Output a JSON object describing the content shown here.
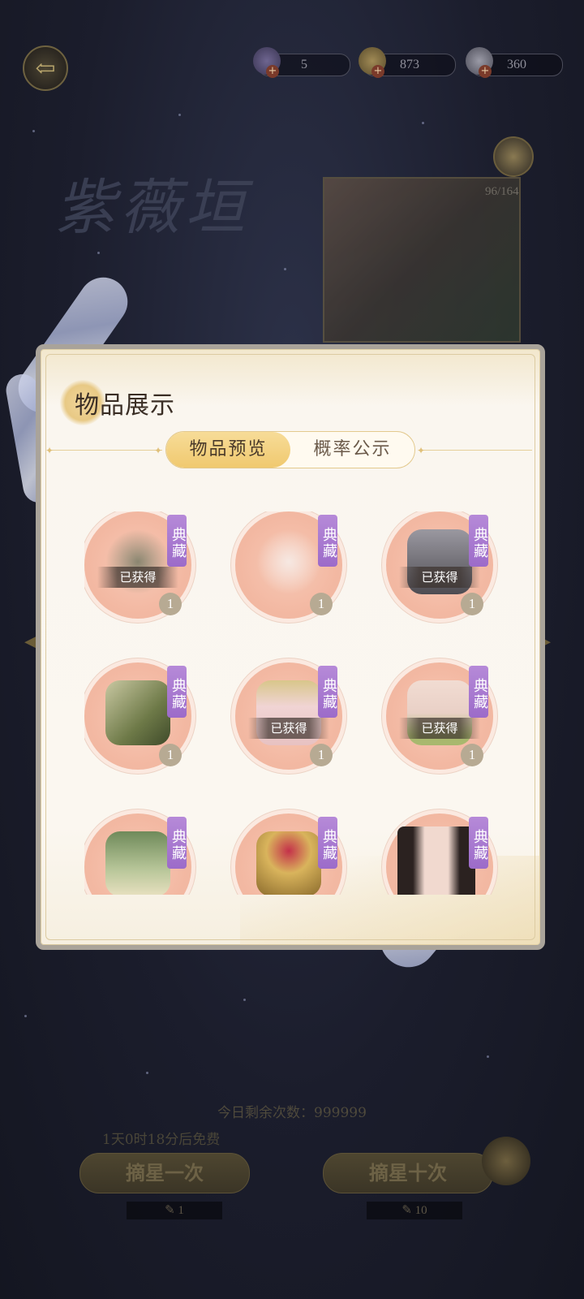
{
  "header": {
    "back_icon": "back-arrow-icon",
    "resources": [
      {
        "name": "ticket",
        "icon": "ticket-icon",
        "value": "5"
      },
      {
        "name": "coin",
        "icon": "coin-icon",
        "value": "873"
      },
      {
        "name": "pearl",
        "icon": "pearl-icon",
        "value": "360"
      }
    ]
  },
  "background": {
    "title": "紫薇垣",
    "progress": "96/164",
    "remaining_label": "今日剩余次数：999999",
    "free_timer": "1天0时18分后免费",
    "draw_once_label": "摘星一次",
    "draw_ten_label": "摘星十次",
    "draw_once_cost": "1",
    "draw_ten_cost": "10"
  },
  "modal": {
    "title": "物品展示",
    "tabs": [
      {
        "label": "物品预览",
        "active": true
      },
      {
        "label": "概率公示",
        "active": false
      }
    ],
    "items": [
      {
        "tag": "典藏",
        "obtained": "已获得",
        "count": "1",
        "art": "accessory-pieces",
        "color": "#8a8670"
      },
      {
        "tag": "典藏",
        "obtained": "",
        "count": "1",
        "art": "white-ribbon",
        "color": "#f1ddd3"
      },
      {
        "tag": "典藏",
        "obtained": "已获得",
        "count": "1",
        "art": "silver-chest",
        "color": "#6c6a70"
      },
      {
        "tag": "典藏",
        "obtained": "",
        "count": "1",
        "art": "green-robe",
        "color": "#7d8a5a"
      },
      {
        "tag": "典藏",
        "obtained": "已获得",
        "count": "1",
        "art": "veil-headdress",
        "color": "#e8c2c2"
      },
      {
        "tag": "典藏",
        "obtained": "已获得",
        "count": "1",
        "art": "green-shoe",
        "color": "#a8b86e"
      },
      {
        "tag": "典藏",
        "obtained": "",
        "count": "",
        "art": "green-dress",
        "color": "#9fb07c"
      },
      {
        "tag": "典藏",
        "obtained": "",
        "count": "",
        "art": "flower-basket",
        "color": "#c9a04a"
      },
      {
        "tag": "典藏",
        "obtained": "",
        "count": "",
        "art": "portrait-hair",
        "color": "#2b2220"
      }
    ]
  },
  "colors": {
    "tag_purple": "#9c6bc9",
    "tab_active_gold": "#f0c96f",
    "item_bg_pink": "#f3b9a3"
  }
}
